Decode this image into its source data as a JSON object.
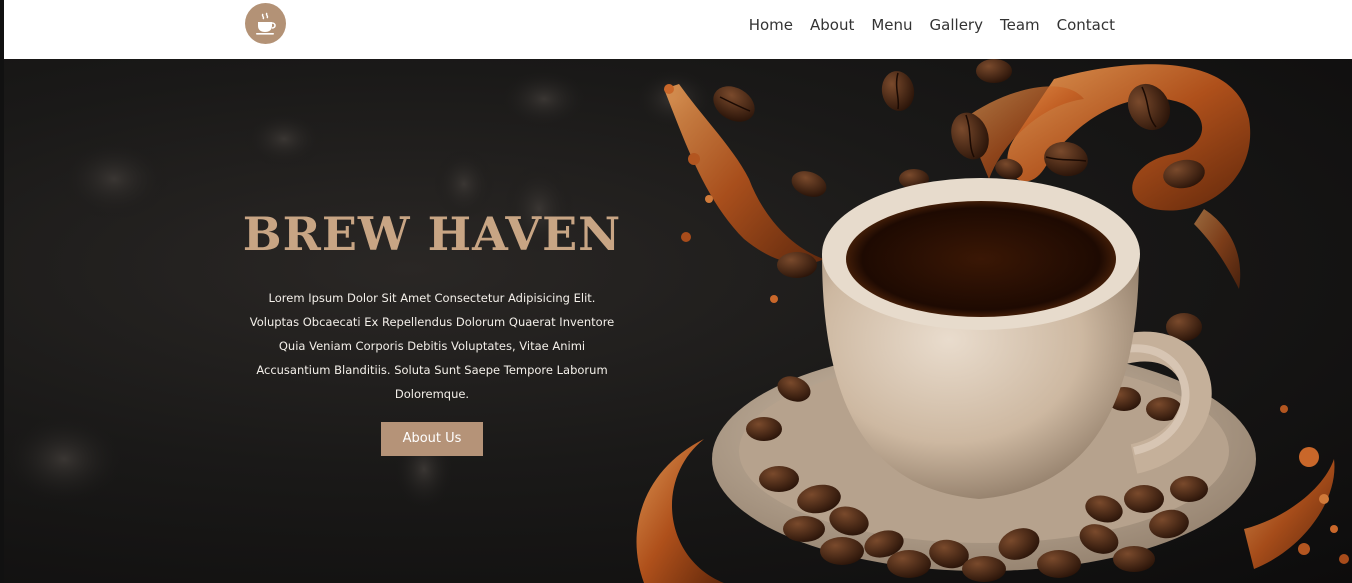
{
  "brand": {
    "logo_icon": "coffee-cup-icon",
    "accent_color": "#b39276"
  },
  "nav": {
    "items": [
      {
        "label": "Home"
      },
      {
        "label": "About"
      },
      {
        "label": "Menu"
      },
      {
        "label": "Gallery"
      },
      {
        "label": "Team"
      },
      {
        "label": "Contact"
      }
    ]
  },
  "hero": {
    "title": "BREW HAVEN",
    "title_color": "#c8a584",
    "description": "Lorem Ipsum Dolor Sit Amet Consectetur Adipisicing Elit. Voluptas Obcaecati Ex Repellendus Dolorum Quaerat Inventore Quia Veniam Corporis Debitis Voluptates, Vitae Animi Accusantium Blanditiis. Soluta Sunt Saepe Tempore Laborum Doloremque.",
    "button_label": "About Us",
    "button_color": "#b59378",
    "image_icon": "coffee-cup-splash-image"
  }
}
